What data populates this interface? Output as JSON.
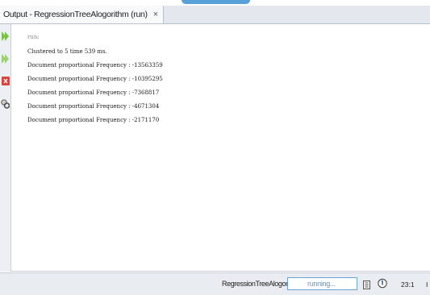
{
  "window": {
    "tab_title": "Output - RegressionTreeAlogorithm (run)",
    "tab_close_glyph": "×"
  },
  "toolbar": {
    "icons": [
      "rerun-icon",
      "rerun-with-options-icon",
      "stop-icon",
      "settings-icon"
    ]
  },
  "output": {
    "lines": [
      "run:",
      "Clustered to 5 time 539 ms.",
      "Document proportional Frequency : -13563359",
      "Document proportional Frequency : -10395295",
      "Document proportional Frequency : -7368817",
      "Document proportional Frequency : -4671304",
      "Document proportional Frequency : -2171170"
    ]
  },
  "statusbar": {
    "task_label": "RegressionTreeAlogorithm (run)",
    "progress_text": "running...",
    "caret_position": "23:1",
    "insert_mode": "I"
  },
  "colors": {
    "accent": "#5aa0d8",
    "stop_red": "#d9433e",
    "rerun_green": "#7cc146"
  }
}
